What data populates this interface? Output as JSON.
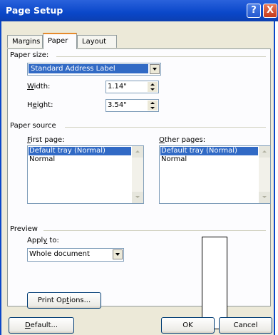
{
  "title": "Page Setup",
  "titlebar": {
    "help_glyph": "?",
    "close_glyph": "X"
  },
  "tabs": [
    "Margins",
    "Paper",
    "Layout"
  ],
  "paper_size": {
    "group_label": "Paper size:",
    "selected": "Standard Address Label",
    "width_label": "Width:",
    "width_value": "1.14\"",
    "height_label": "Height:",
    "height_value": "3.54\""
  },
  "paper_source": {
    "group_label": "Paper source",
    "first_page_label": "First page:",
    "first_page_items": [
      "Default tray (Normal)",
      "Normal"
    ],
    "other_pages_label": "Other pages:",
    "other_pages_items": [
      "Default tray (Normal)",
      "Normal"
    ]
  },
  "preview": {
    "group_label": "Preview",
    "apply_to_label": "Apply to:",
    "apply_to_value": "Whole document"
  },
  "buttons": {
    "print_options": "Print Options...",
    "default": "Default...",
    "ok": "OK",
    "cancel": "Cancel"
  }
}
